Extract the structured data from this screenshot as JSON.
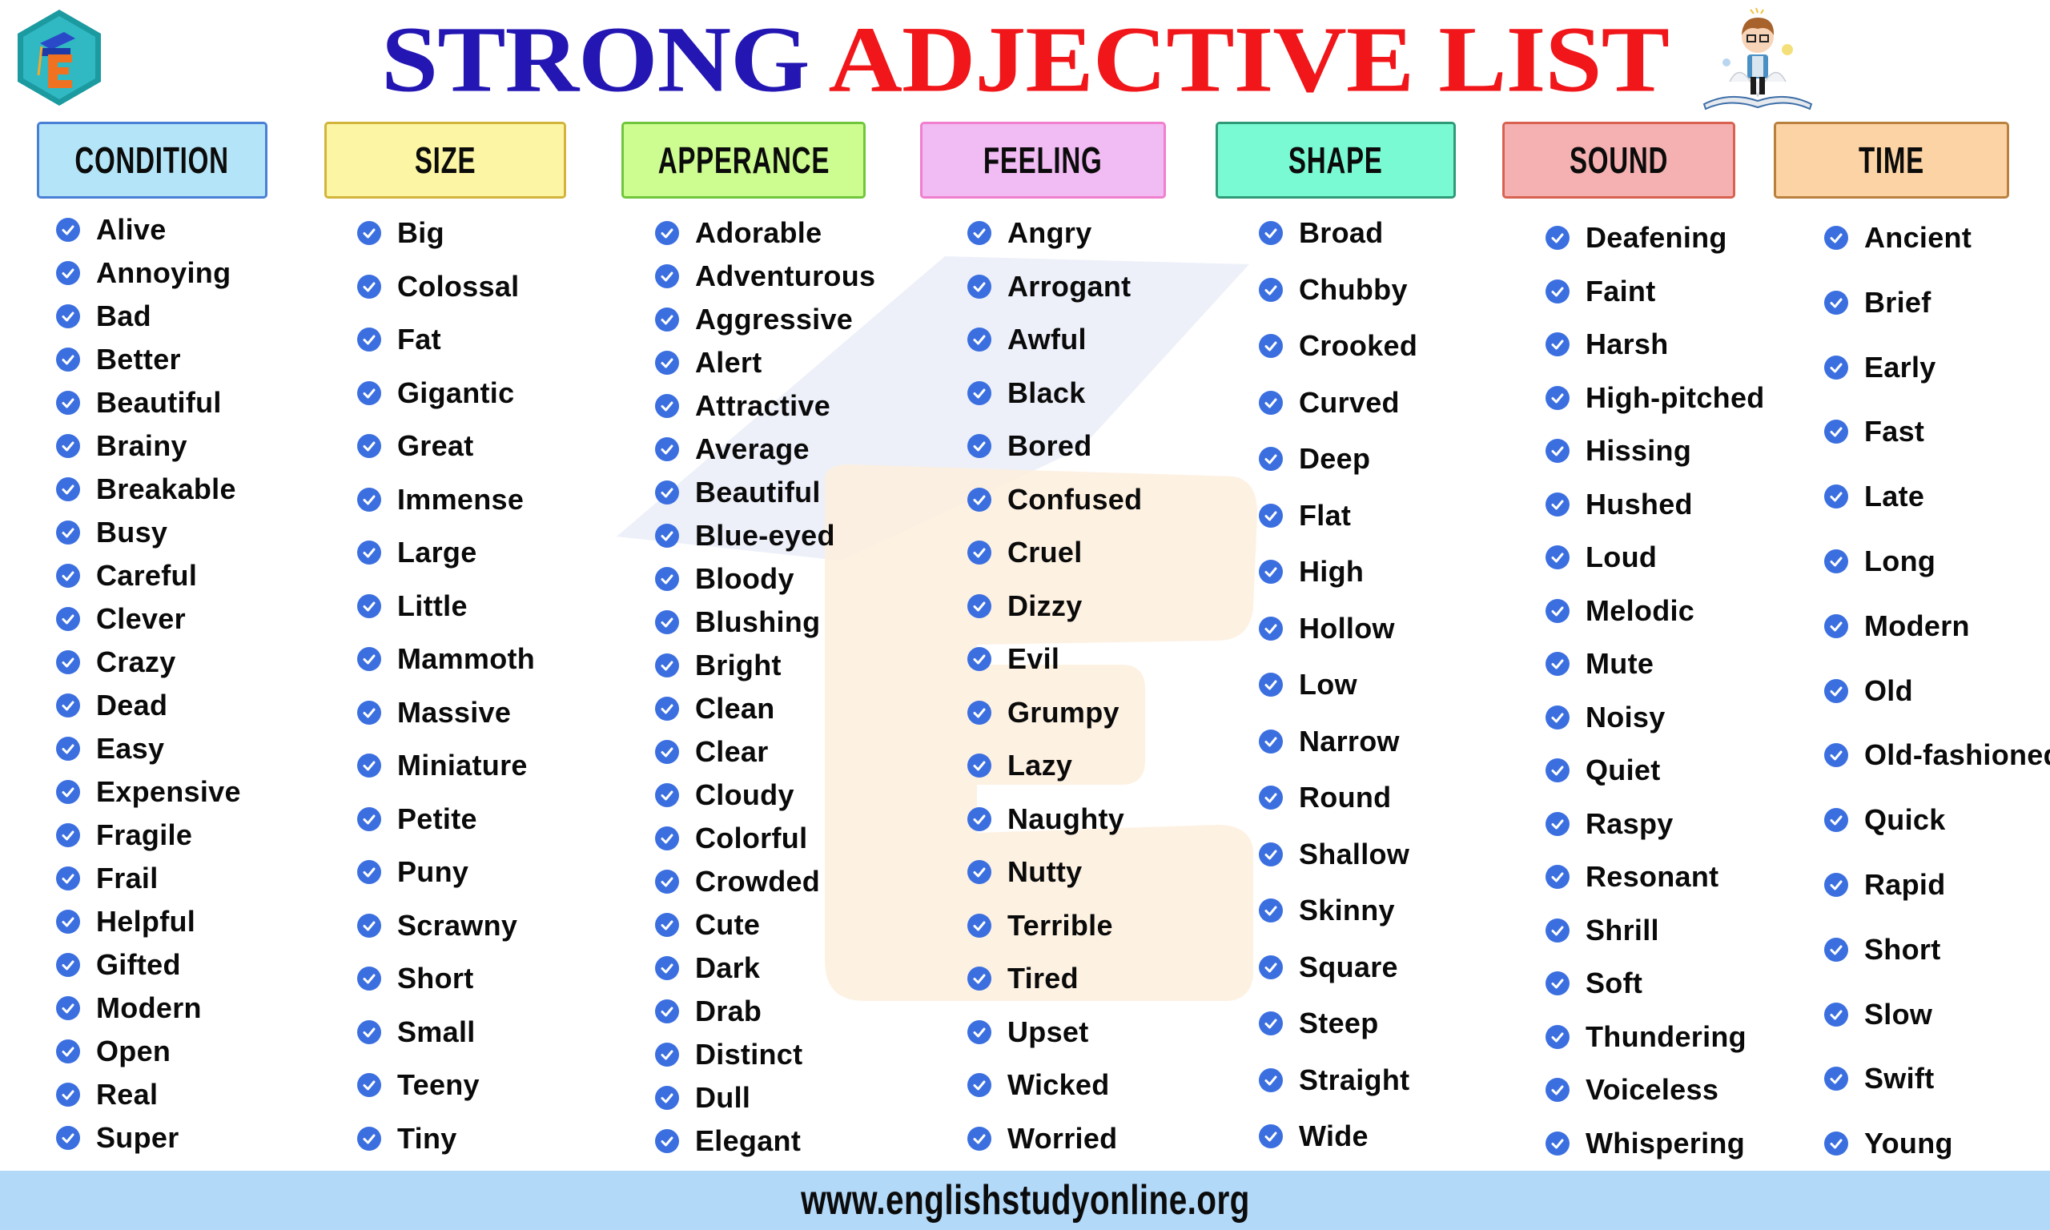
{
  "title": {
    "part1": "STRONG",
    "part2": "ADJECTIVE LIST"
  },
  "colors": {
    "title_blue": "#2316b3",
    "title_red": "#f0161a",
    "check_blue": "#3b6fe0",
    "footer_bg": "#b3d9f8"
  },
  "logo": {
    "icon": "graduation-cap-e-logo",
    "letter": "E"
  },
  "mascot": {
    "icon": "student-reading-book-illustration"
  },
  "categories": [
    {
      "name": "CONDITION",
      "bg": "#b4e4f7",
      "border": "#4a7fd6",
      "items": [
        "Alive",
        "Annoying",
        "Bad",
        "Better",
        "Beautiful",
        "Brainy",
        "Breakable",
        "Busy",
        "Careful",
        "Clever",
        "Crazy",
        "Dead",
        "Easy",
        "Expensive",
        "Fragile",
        "Frail",
        "Helpful",
        "Gifted",
        "Modern",
        "Open",
        "Real",
        "Super"
      ]
    },
    {
      "name": "SIZE",
      "bg": "#fcf5a3",
      "border": "#d3b43b",
      "items": [
        "Big",
        "Colossal",
        "Fat",
        "Gigantic",
        "Great",
        "Immense",
        "Large",
        "Little",
        "Mammoth",
        "Massive",
        "Miniature",
        "Petite",
        "Puny",
        "Scrawny",
        "Short",
        "Small",
        "Teeny",
        "Tiny"
      ]
    },
    {
      "name": "APPERANCE",
      "bg": "#cdfc91",
      "border": "#6fc63a",
      "items": [
        "Adorable",
        "Adventurous",
        "Aggressive",
        "Alert",
        "Attractive",
        "Average",
        "Beautiful",
        "Blue-eyed",
        "Bloody",
        "Blushing",
        "Bright",
        "Clean",
        "Clear",
        "Cloudy",
        "Colorful",
        "Crowded",
        "Cute",
        "Dark",
        "Drab",
        "Distinct",
        "Dull",
        "Elegant"
      ]
    },
    {
      "name": "FEELING",
      "bg": "#f1bbf3",
      "border": "#f07fce",
      "items": [
        "Angry",
        "Arrogant",
        "Awful",
        "Black",
        "Bored",
        "Confused",
        "Cruel",
        "Dizzy",
        "Evil",
        "Grumpy",
        "Lazy",
        "Naughty",
        "Nutty",
        "Terrible",
        "Tired",
        "Upset",
        "Wicked",
        "Worried"
      ]
    },
    {
      "name": "SHAPE",
      "bg": "#7afad3",
      "border": "#2f9a78",
      "items": [
        "Broad",
        "Chubby",
        "Crooked",
        "Curved",
        "Deep",
        "Flat",
        "High",
        "Hollow",
        "Low",
        "Narrow",
        "Round",
        "Shallow",
        "Skinny",
        "Square",
        "Steep",
        "Straight",
        "Wide"
      ]
    },
    {
      "name": "SOUND",
      "bg": "#f5b1b1",
      "border": "#d8614f",
      "items": [
        "Deafening",
        "Faint",
        "Harsh",
        "High-pitched",
        "Hissing",
        "Hushed",
        "Loud",
        "Melodic",
        "Mute",
        "Noisy",
        "Quiet",
        "Raspy",
        "Resonant",
        "Shrill",
        "Soft",
        "Thundering",
        "Voiceless",
        "Whispering"
      ]
    },
    {
      "name": "TIME",
      "bg": "#fcd3a4",
      "border": "#b9813d",
      "items": [
        "Ancient",
        "Brief",
        "Early",
        "Fast",
        "Late",
        "Long",
        "Modern",
        "Old",
        "Old-fashioned",
        "Quick",
        "Rapid",
        "Short",
        "Slow",
        "Swift",
        "Young"
      ]
    }
  ],
  "footer": {
    "url": "www.englishstudyonline.org"
  }
}
